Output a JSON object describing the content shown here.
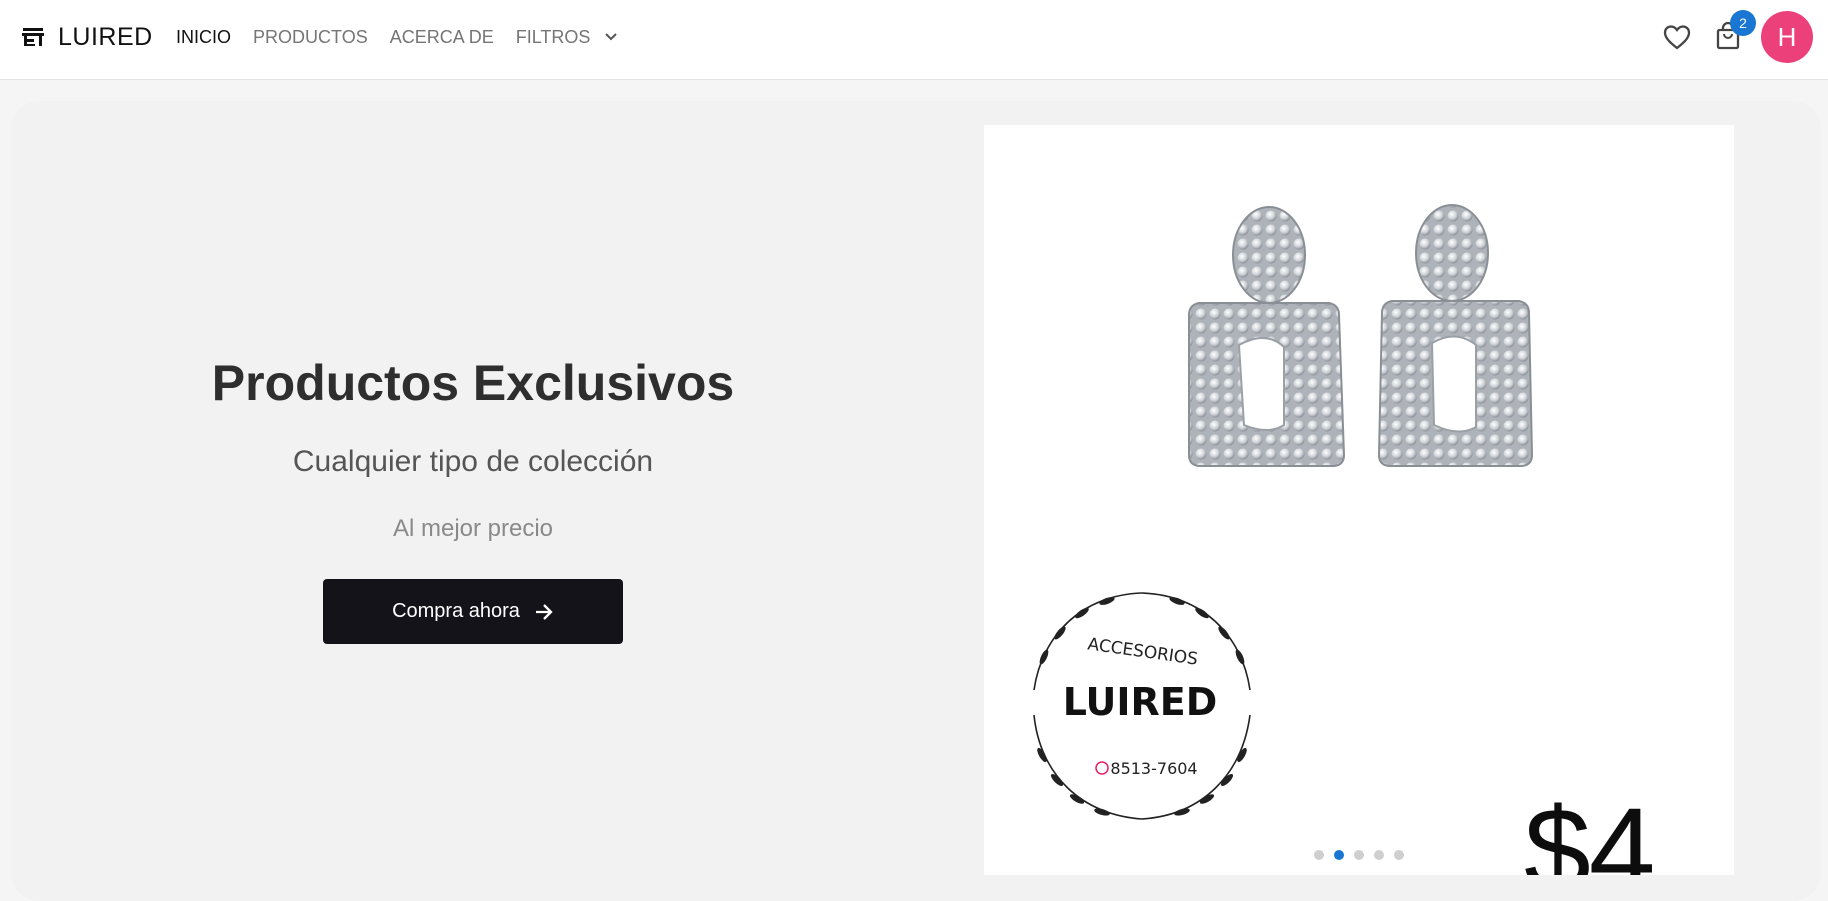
{
  "header": {
    "brand": "LUIRED",
    "nav": [
      {
        "label": "INICIO",
        "active": true
      },
      {
        "label": "PRODUCTOS",
        "active": false
      },
      {
        "label": "ACERCA DE",
        "active": false
      },
      {
        "label": "FILTROS",
        "active": false
      }
    ],
    "cart_count": "2",
    "avatar_initial": "H",
    "icons": [
      "storefront-icon",
      "chevron-down-icon",
      "heart-icon",
      "shopping-bag-icon"
    ],
    "colors": {
      "badge": "#1976d2",
      "avatar": "#ec407a"
    }
  },
  "hero": {
    "title": "Productos Exclusivos",
    "subtitle": "Cualquier tipo de colección",
    "tagline": "Al mejor precio",
    "cta_label": "Compra ahora",
    "cta_icon": "arrow-right-icon"
  },
  "carousel": {
    "slide": {
      "logo_top_text": "ACCESORIOS",
      "logo_brand": "LUIRED",
      "logo_phone": "8513-7604",
      "price": "$4"
    },
    "dot_count": 5,
    "active_dot": 2
  }
}
